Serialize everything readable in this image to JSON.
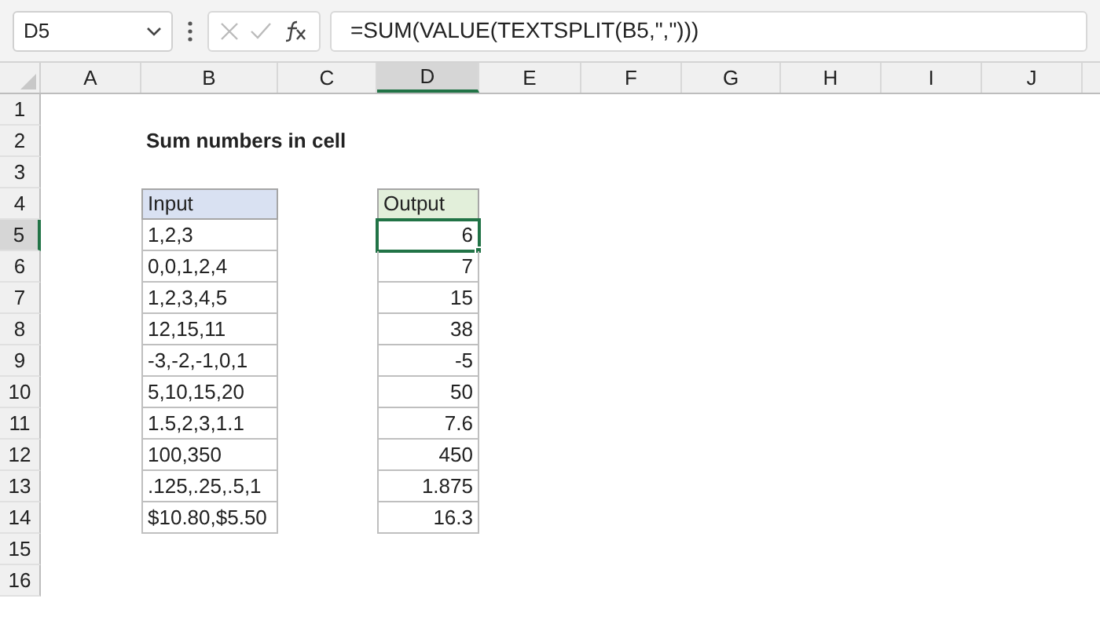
{
  "name_box": "D5",
  "formula": "=SUM(VALUE(TEXTSPLIT(B5,\",\")))",
  "columns": [
    {
      "label": "A",
      "selected": false
    },
    {
      "label": "B",
      "selected": false
    },
    {
      "label": "C",
      "selected": false
    },
    {
      "label": "D",
      "selected": true
    },
    {
      "label": "E",
      "selected": false
    },
    {
      "label": "F",
      "selected": false
    },
    {
      "label": "G",
      "selected": false
    },
    {
      "label": "H",
      "selected": false
    },
    {
      "label": "I",
      "selected": false
    },
    {
      "label": "J",
      "selected": false
    }
  ],
  "row_numbers": [
    {
      "label": "1",
      "selected": false
    },
    {
      "label": "2",
      "selected": false
    },
    {
      "label": "3",
      "selected": false
    },
    {
      "label": "4",
      "selected": false
    },
    {
      "label": "5",
      "selected": true
    },
    {
      "label": "6",
      "selected": false
    },
    {
      "label": "7",
      "selected": false
    },
    {
      "label": "8",
      "selected": false
    },
    {
      "label": "9",
      "selected": false
    },
    {
      "label": "10",
      "selected": false
    },
    {
      "label": "11",
      "selected": false
    },
    {
      "label": "12",
      "selected": false
    },
    {
      "label": "13",
      "selected": false
    },
    {
      "label": "14",
      "selected": false
    },
    {
      "label": "15",
      "selected": false
    },
    {
      "label": "16",
      "selected": false
    }
  ],
  "title": "Sum numbers in cell",
  "headers": [
    "Input",
    "Output"
  ],
  "rows": [
    {
      "input": "1,2,3",
      "output": "6",
      "selected": true
    },
    {
      "input": "0,0,1,2,4",
      "output": "7",
      "selected": false
    },
    {
      "input": "1,2,3,4,5",
      "output": "15",
      "selected": false
    },
    {
      "input": "12,15,11",
      "output": "38",
      "selected": false
    },
    {
      "input": "-3,-2,-1,0,1",
      "output": "-5",
      "selected": false
    },
    {
      "input": "5,10,15,20",
      "output": "50",
      "selected": false
    },
    {
      "input": "1.5,2,3,1.1",
      "output": "7.6",
      "selected": false
    },
    {
      "input": "100,350",
      "output": "450",
      "selected": false
    },
    {
      "input": ".125,.25,.5,1",
      "output": "1.875",
      "selected": false
    },
    {
      "input": "$10.80,$5.50",
      "output": "16.3",
      "selected": false
    }
  ]
}
